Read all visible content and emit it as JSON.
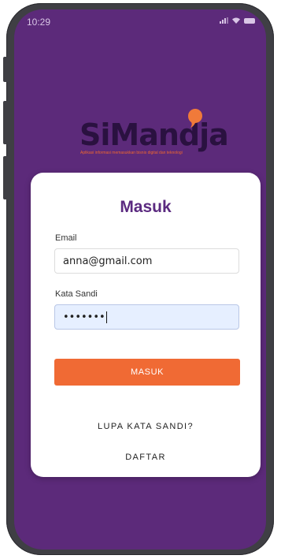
{
  "status_bar": {
    "time": "10:29",
    "icons": [
      "signal-icon",
      "wifi-icon",
      "battery-icon"
    ]
  },
  "logo": {
    "wordmark": "SiMandja",
    "tagline": "Aplikasi informasi memasukkan bisnis digital dan teknologi"
  },
  "login": {
    "title": "Masuk",
    "email_label": "Email",
    "email_value": "anna@gmail.com",
    "password_label": "Kata Sandi",
    "password_value": "•••••••",
    "submit_label": "MASUK",
    "forgot_label": "LUPA KATA SANDI?",
    "register_label": "DAFTAR"
  },
  "colors": {
    "background": "#5c2a7a",
    "primary_button": "#f06a34",
    "title": "#5b2a80",
    "card": "#ffffff",
    "focused_input": "#e6efff"
  }
}
